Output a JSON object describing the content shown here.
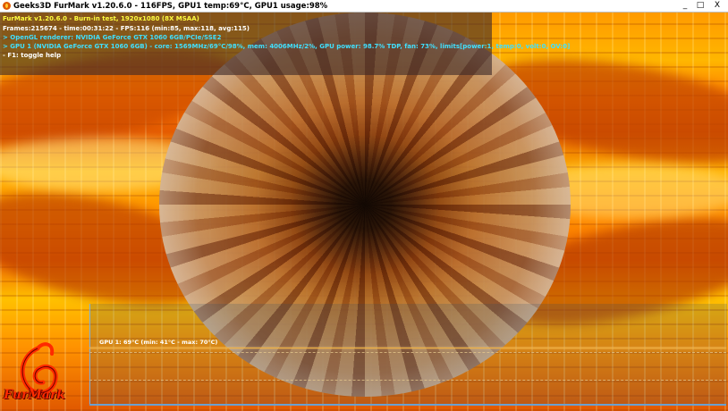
{
  "window": {
    "title": "Geeks3D FurMark v1.20.6.0 - 116FPS, GPU1 temp:69°C, GPU1 usage:98%",
    "buttons": {
      "minimize": "_",
      "maximize": "□",
      "close": "X"
    }
  },
  "osd": {
    "line1": "FurMark v1.20.6.0 - Burn-in test, 1920x1080 (8X MSAA)",
    "line2": "Frames:215674 - time:00:31:22 - FPS:116 (min:85, max:118, avg:115)",
    "line3": "> OpenGL renderer: NVIDIA GeForce GTX 1060 6GB/PCIe/SSE2",
    "line4": "> GPU 1 (NVIDIA GeForce GTX 1060 6GB) - core: 1569MHz/69°C/98%, mem: 4006MHz/2%, GPU power: 98.7% TDP, fan: 73%, limits[power:1, temp:0, volt:0, OV:0]",
    "line5": "- F1: toggle help"
  },
  "graph": {
    "label": "GPU 1: 69°C (min: 41°C - max: 70°C)"
  },
  "logo": {
    "text": "FurMark"
  },
  "colors": {
    "osd_title": "#ffff40",
    "osd_gpu": "#40e0ff",
    "temp_line": "#f0b040",
    "logo": "#ff2a00"
  }
}
